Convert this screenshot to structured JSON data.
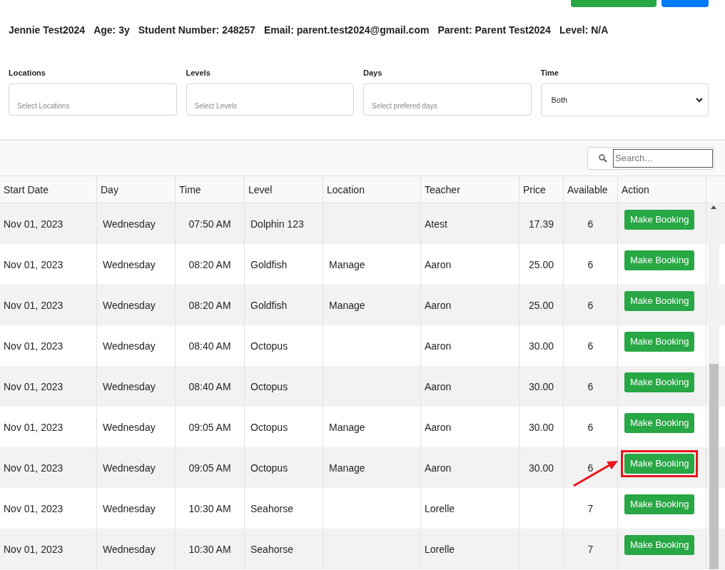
{
  "student_info": [
    "Jennie Test2024",
    "Age: 3y",
    "Student Number: 248257",
    "Email: parent.test2024@gmail.com",
    "Parent: Parent Test2024",
    "Level: N/A"
  ],
  "filters": [
    {
      "kind": "multiselect",
      "label": "Locations",
      "placeholder": "Select Locations"
    },
    {
      "kind": "multiselect",
      "label": "Levels",
      "placeholder": "Select Levels"
    },
    {
      "kind": "multiselect",
      "label": "Days",
      "placeholder": "Select prefered days"
    },
    {
      "kind": "select",
      "label": "Time",
      "value": "Both"
    }
  ],
  "table": {
    "search": {
      "placeholder": "Search..."
    },
    "columns": [
      "Start Date",
      "Day",
      "Time",
      "Level",
      "Location",
      "Teacher",
      "Price",
      "Available",
      "Action"
    ],
    "rows": [
      {
        "cells": [
          "Nov 01, 2023",
          "Wednesday",
          "07:50 AM",
          "Dolphin 123",
          "",
          "Atest",
          "17.39",
          "6"
        ],
        "action": "Make Booking",
        "highlighted": false
      },
      {
        "cells": [
          "Nov 01, 2023",
          "Wednesday",
          "08:20 AM",
          "Goldfish",
          "Manage",
          "Aaron",
          "25.00",
          "6"
        ],
        "action": "Make Booking",
        "highlighted": false
      },
      {
        "cells": [
          "Nov 01, 2023",
          "Wednesday",
          "08:20 AM",
          "Goldfish",
          "Manage",
          "Aaron",
          "25.00",
          "6"
        ],
        "action": "Make Booking",
        "highlighted": false
      },
      {
        "cells": [
          "Nov 01, 2023",
          "Wednesday",
          "08:40 AM",
          "Octopus",
          "",
          "Aaron",
          "30.00",
          "6"
        ],
        "action": "Make Booking",
        "highlighted": false
      },
      {
        "cells": [
          "Nov 01, 2023",
          "Wednesday",
          "08:40 AM",
          "Octopus",
          "",
          "Aaron",
          "30.00",
          "6"
        ],
        "action": "Make Booking",
        "highlighted": false
      },
      {
        "cells": [
          "Nov 01, 2023",
          "Wednesday",
          "09:05 AM",
          "Octopus",
          "Manage",
          "Aaron",
          "30.00",
          "6"
        ],
        "action": "Make Booking",
        "highlighted": false
      },
      {
        "cells": [
          "Nov 01, 2023",
          "Wednesday",
          "09:05 AM",
          "Octopus",
          "Manage",
          "Aaron",
          "30.00",
          "6"
        ],
        "action": "Make Booking",
        "highlighted": true
      },
      {
        "cells": [
          "Nov 01, 2023",
          "Wednesday",
          "10:30 AM",
          "Seahorse",
          "",
          "Lorelle",
          "",
          "7"
        ],
        "action": "Make Booking",
        "highlighted": false
      },
      {
        "cells": [
          "Nov 01, 2023",
          "Wednesday",
          "10:30 AM",
          "Seahorse",
          "",
          "Lorelle",
          "",
          "7"
        ],
        "action": "Make Booking",
        "highlighted": false
      }
    ]
  }
}
